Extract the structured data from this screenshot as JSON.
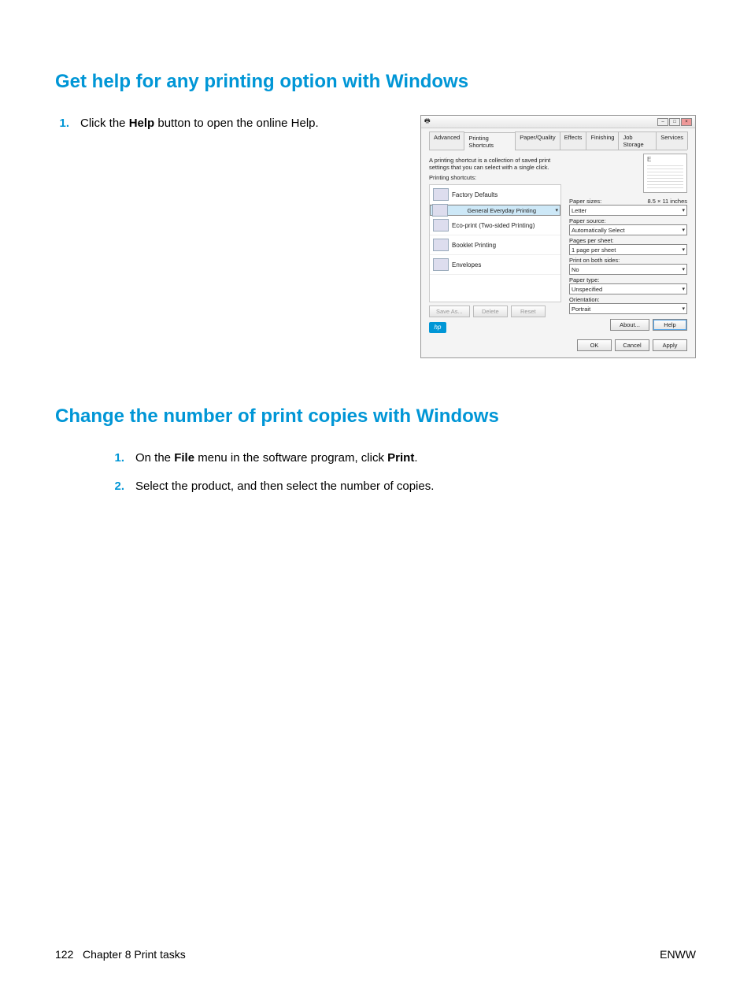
{
  "section1": {
    "heading": "Get help for any printing option with Windows",
    "step1_num": "1.",
    "step1_pre": "Click the ",
    "step1_bold": "Help",
    "step1_post": " button to open the online Help."
  },
  "section2": {
    "heading": "Change the number of print copies with Windows",
    "step1_num": "1.",
    "step1_pre": "On the ",
    "step1_bold1": "File",
    "step1_mid": " menu in the software program, click ",
    "step1_bold2": "Print",
    "step1_post": ".",
    "step2_num": "2.",
    "step2_text": "Select the product, and then select the number of copies."
  },
  "dialog": {
    "tabs": [
      "Advanced",
      "Printing Shortcuts",
      "Paper/Quality",
      "Effects",
      "Finishing",
      "Job Storage",
      "Services"
    ],
    "active_tab": 1,
    "desc": "A printing shortcut is a collection of saved print settings that you can select with a single click.",
    "list_label": "Printing shortcuts:",
    "shortcuts": [
      "Factory Defaults",
      "General Everyday Printing",
      "Eco-print (Two-sided Printing)",
      "Booklet Printing",
      "Envelopes"
    ],
    "fields": {
      "paper_sizes_lbl": "Paper sizes:",
      "paper_sizes_dim": "8.5 × 11 inches",
      "paper_sizes_val": "Letter",
      "paper_source_lbl": "Paper source:",
      "paper_source_val": "Automatically Select",
      "ppp_lbl": "Pages per sheet:",
      "ppp_val": "1 page per sheet",
      "both_lbl": "Print on both sides:",
      "both_val": "No",
      "ptype_lbl": "Paper type:",
      "ptype_val": "Unspecified",
      "orient_lbl": "Orientation:",
      "orient_val": "Portrait"
    },
    "btns": {
      "save_as": "Save As...",
      "delete": "Delete",
      "reset": "Reset",
      "about": "About...",
      "help": "Help",
      "ok": "OK",
      "cancel": "Cancel",
      "apply": "Apply"
    },
    "logo": "hp"
  },
  "footer": {
    "left_page": "122",
    "left_text": "Chapter 8   Print tasks",
    "right": "ENWW"
  }
}
